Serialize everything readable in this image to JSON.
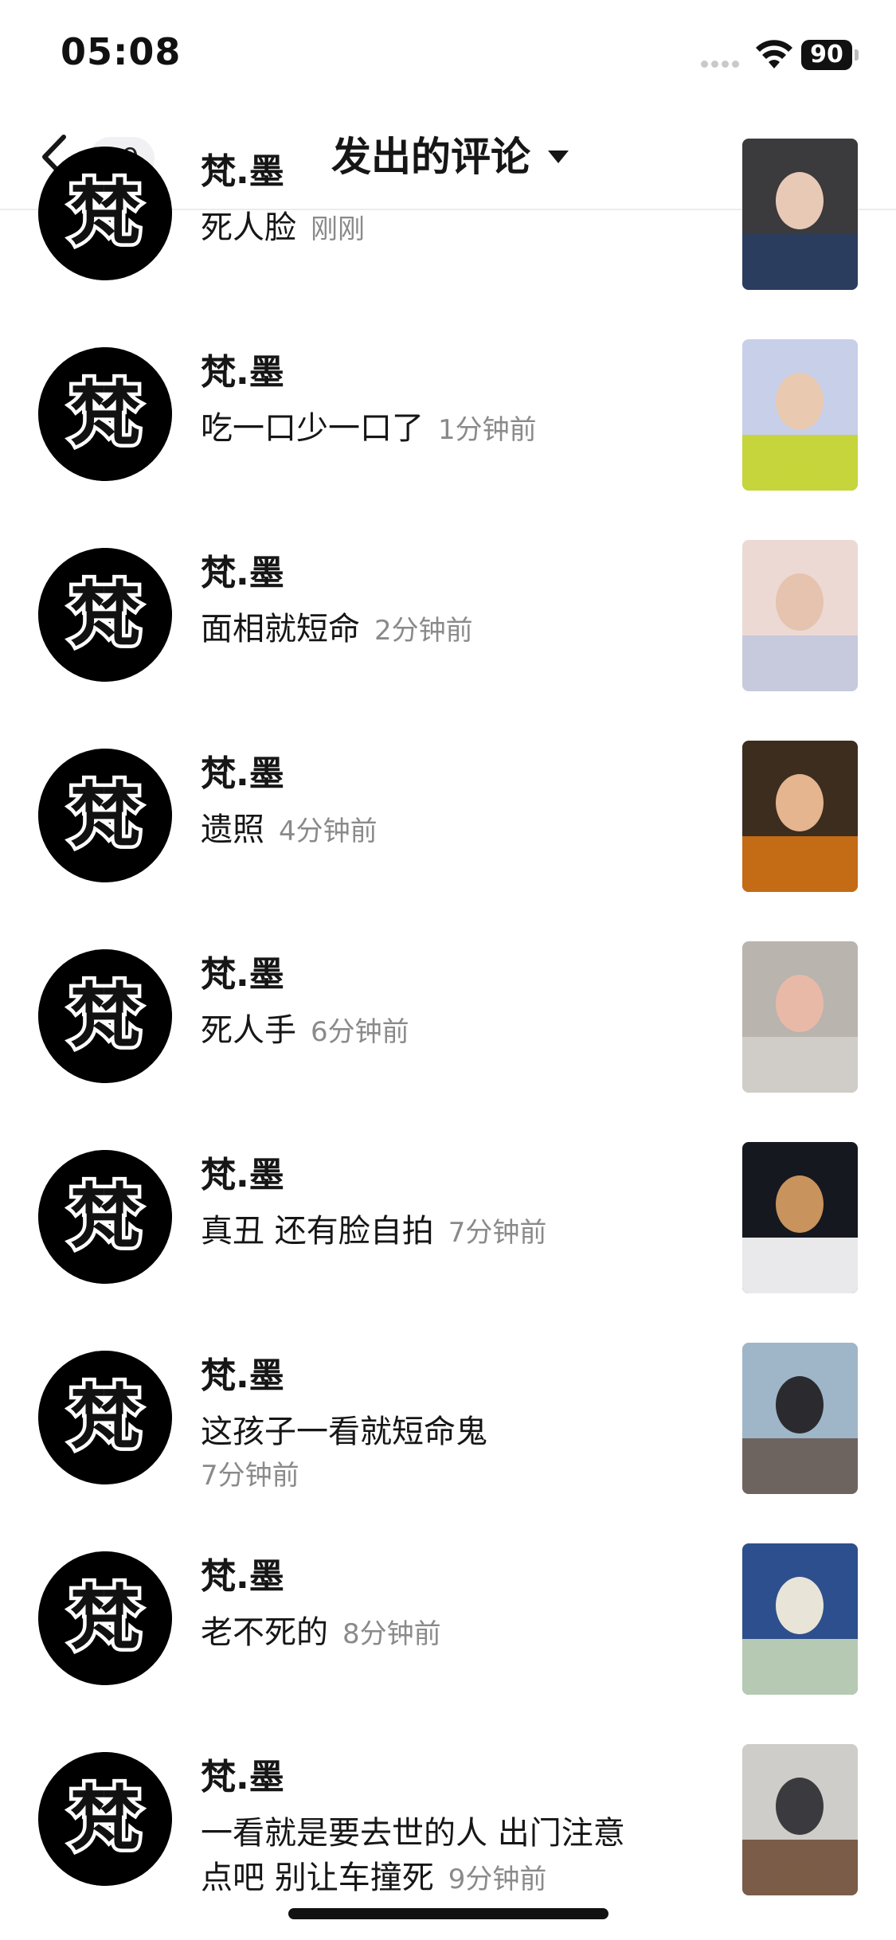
{
  "status_bar": {
    "time": "05:08",
    "battery": "90"
  },
  "header": {
    "badge": "99",
    "title": "发出的评论"
  },
  "comments": [
    {
      "user": "梵.墨",
      "text": "死人脸",
      "time": "刚刚",
      "thumb_colors": [
        "#3b3a3d",
        "#e8c9b6",
        "#2a3d5f"
      ]
    },
    {
      "user": "梵.墨",
      "text": "吃一口少一口了",
      "time": "1分钟前",
      "thumb_colors": [
        "#c7cfe9",
        "#e9c9b0",
        "#c5d53b"
      ]
    },
    {
      "user": "梵.墨",
      "text": "面相就短命",
      "time": "2分钟前",
      "thumb_colors": [
        "#ecd9d3",
        "#e5c3ae",
        "#c7c9dc"
      ]
    },
    {
      "user": "梵.墨",
      "text": "遗照",
      "time": "4分钟前",
      "thumb_colors": [
        "#3c2d1f",
        "#e4b58e",
        "#c46b16"
      ]
    },
    {
      "user": "梵.墨",
      "text": "死人手",
      "time": "6分钟前",
      "thumb_colors": [
        "#b9b4ad",
        "#e9b9a8",
        "#d0cdc8"
      ]
    },
    {
      "user": "梵.墨",
      "text": "真丑 还有脸自拍",
      "time": "7分钟前",
      "thumb_colors": [
        "#15181f",
        "#c8935c",
        "#e9e9ec"
      ]
    },
    {
      "user": "梵.墨",
      "text": "这孩子一看就短命鬼",
      "time": "7分钟前",
      "thumb_colors": [
        "#9fb6c8",
        "#2b2b2f",
        "#6d6460"
      ]
    },
    {
      "user": "梵.墨",
      "text": "老不死的",
      "time": "8分钟前",
      "thumb_colors": [
        "#2e4f8d",
        "#e9e4d8",
        "#b6c9b3"
      ]
    },
    {
      "user": "梵.墨",
      "text": "一看就是要去世的人 出门注意点吧 别让车撞死",
      "time": "9分钟前",
      "thumb_colors": [
        "#cfcdc9",
        "#3b3b3f",
        "#7a5c48"
      ]
    }
  ],
  "avatar_glyph": "梵"
}
